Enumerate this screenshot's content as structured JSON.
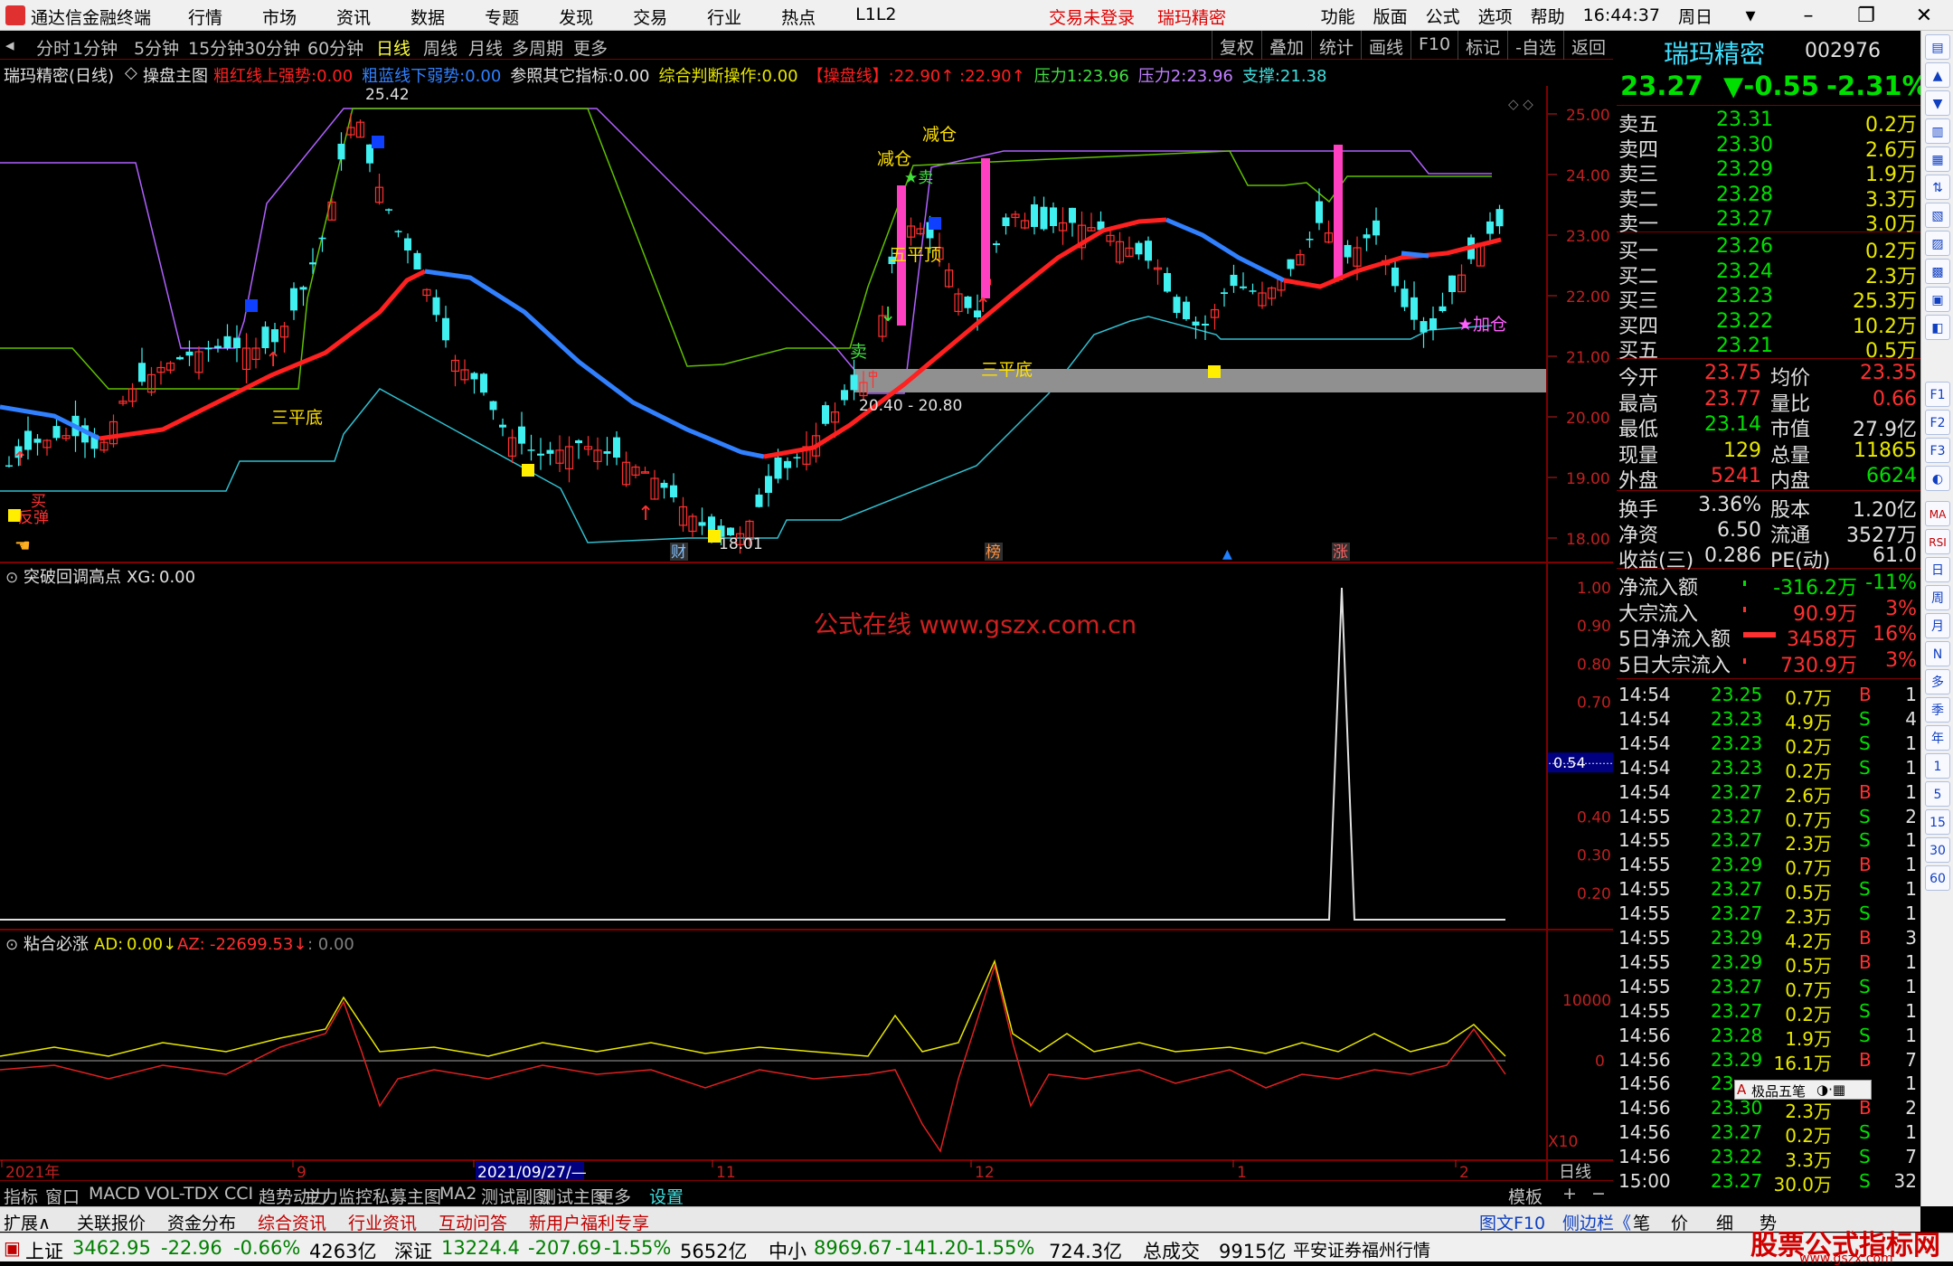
{
  "app": {
    "title": "通达信金融终端",
    "menus": [
      "行情",
      "市场",
      "资讯",
      "数据",
      "专题",
      "发现",
      "交易",
      "行业",
      "热点",
      "L1L2"
    ],
    "login_status": "交易未登录",
    "stock_title": "瑞玛精密",
    "top_right": [
      "功能",
      "版面",
      "公式",
      "选项",
      "帮助"
    ],
    "clock": "16:44:37",
    "weekday": "周日"
  },
  "period_bar": {
    "periods": [
      "分时",
      "1分钟",
      "5分钟",
      "15分钟",
      "30分钟",
      "60分钟",
      "日线",
      "周线",
      "月线",
      "多周期",
      "更多"
    ],
    "active": "日线",
    "tools": [
      "复权",
      "叠加",
      "统计",
      "画线",
      "F10",
      "标记",
      "-自选",
      "返回"
    ]
  },
  "info_bar": {
    "name": "瑞玛精密(日线)",
    "formula": "操盘主图",
    "items": [
      {
        "label": "粗红线上强势:",
        "value": "0.00",
        "color": "#ff2020"
      },
      {
        "label": "粗蓝线下弱势:",
        "value": "0.00",
        "color": "#3080ff"
      },
      {
        "label": "参照其它指标:",
        "value": "0.00",
        "color": "#e0e0e0"
      },
      {
        "label": "综合判断操作:",
        "value": "0.00",
        "color": "#e8e800"
      },
      {
        "label": "【操盘线】:",
        "value": "22.90↑ :22.90↑",
        "color": "#ff2020"
      },
      {
        "label": "压力1:",
        "value": "23.96",
        "color": "#40e040"
      },
      {
        "label": "压力2:",
        "value": "23.96",
        "color": "#c080ff"
      },
      {
        "label": "支撑:",
        "value": "21.38",
        "color": "#40e0e0"
      }
    ]
  },
  "main_chart": {
    "y_ticks": [
      "25.00",
      "24.00",
      "23.00",
      "22.00",
      "21.00",
      "20.00",
      "19.00",
      "18.00"
    ],
    "labels": {
      "high": "25.42",
      "low": "18.01",
      "range": "20.40 - 20.80",
      "sanpingdi_1": "三平底",
      "sanpingdi_2": "三平底",
      "wupingding": "五平顶",
      "sell": "卖",
      "buy": "买",
      "fantan": "反弹",
      "jiacang": "★加仓",
      "jianpan_1": "减仓",
      "jianpan_2": "减仓",
      "markers": [
        "财",
        "榜",
        "涨"
      ]
    }
  },
  "indicator1": {
    "name": "突破回调高点",
    "value_label": "XG:",
    "value": "0.00",
    "watermark": "公式在线  www.gszx.com.cn",
    "y_ticks": [
      "1.00",
      "0.90",
      "0.80",
      "0.70",
      "0.54",
      "0.40",
      "0.30",
      "0.20"
    ],
    "highlight": "0.54"
  },
  "indicator2": {
    "name": "粘合必涨",
    "ad_label": "AD:",
    "ad_value": "0.00↓",
    "az_label": "AZ:",
    "az_value": "-22699.53↓",
    "extra": ": 0.00",
    "y_ticks": [
      "10000",
      "0"
    ],
    "x10": "X10"
  },
  "x_axis": {
    "labels": [
      "2021年",
      "9",
      "2021/09/27/—",
      "11",
      "12",
      "1",
      "2"
    ],
    "period": "日线"
  },
  "bottom_tabs": {
    "tabs": [
      "指标",
      "窗口",
      "MACD",
      "VOL-TDX",
      "CCI",
      "趋势动力",
      "主力监控",
      "私募主图",
      "MA2",
      "测试副图",
      "测试主图",
      "更多",
      "设置"
    ],
    "right": [
      "模板",
      "+",
      "−"
    ]
  },
  "bottom_tabs2": {
    "tabs": [
      "扩展∧",
      "关联报价",
      "资金分布",
      "综合资讯",
      "行业资讯",
      "互动问答",
      "新用户福利专享"
    ],
    "right": [
      "图文F10",
      "侧边栏《",
      "笔",
      "价",
      "细",
      "势"
    ]
  },
  "quote": {
    "name": "瑞玛精密",
    "code": "002976",
    "price": "23.27",
    "change": "▼-0.55",
    "change_pct": "-2.31%",
    "asks": [
      {
        "label": "卖五",
        "price": "23.31",
        "vol": "0.2万"
      },
      {
        "label": "卖四",
        "price": "23.30",
        "vol": "2.6万"
      },
      {
        "label": "卖三",
        "price": "23.29",
        "vol": "1.9万"
      },
      {
        "label": "卖二",
        "price": "23.28",
        "vol": "3.3万"
      },
      {
        "label": "卖一",
        "price": "23.27",
        "vol": "3.0万"
      }
    ],
    "bids": [
      {
        "label": "买一",
        "price": "23.26",
        "vol": "0.2万"
      },
      {
        "label": "买二",
        "price": "23.24",
        "vol": "2.3万"
      },
      {
        "label": "买三",
        "price": "23.23",
        "vol": "25.3万"
      },
      {
        "label": "买四",
        "price": "23.22",
        "vol": "10.2万"
      },
      {
        "label": "买五",
        "price": "23.21",
        "vol": "0.5万"
      }
    ],
    "stats": [
      {
        "l1": "今开",
        "v1": "23.75",
        "l2": "均价",
        "v2": "23.35"
      },
      {
        "l1": "最高",
        "v1": "23.77",
        "l2": "量比",
        "v2": "0.66"
      },
      {
        "l1": "最低",
        "v1": "23.14",
        "l2": "市值",
        "v2": "27.9亿"
      },
      {
        "l1": "现量",
        "v1": "129",
        "l2": "总量",
        "v2": "11865"
      },
      {
        "l1": "外盘",
        "v1": "5241",
        "l2": "内盘",
        "v2": "6624"
      }
    ],
    "stats2": [
      {
        "l1": "换手",
        "v1": "3.36%",
        "l2": "股本",
        "v2": "1.20亿"
      },
      {
        "l1": "净资",
        "v1": "6.50",
        "l2": "流通",
        "v2": "3527万"
      },
      {
        "l1": "收益(三)",
        "v1": "0.286",
        "l2": "PE(动)",
        "v2": "61.0"
      }
    ],
    "flows": [
      {
        "label": "净流入额",
        "value": "-316.2万",
        "pct": "-11%"
      },
      {
        "label": "大宗流入",
        "value": "90.9万",
        "pct": "3%"
      },
      {
        "label": "5日净流入额",
        "value": "3458万",
        "pct": "16%"
      },
      {
        "label": "5日大宗流入",
        "value": "730.9万",
        "pct": "3%"
      }
    ],
    "ticks": [
      {
        "t": "14:54",
        "p": "23.25",
        "v": "0.7万",
        "s": "B",
        "n": "1"
      },
      {
        "t": "14:54",
        "p": "23.23",
        "v": "4.9万",
        "s": "S",
        "n": "4"
      },
      {
        "t": "14:54",
        "p": "23.23",
        "v": "0.2万",
        "s": "S",
        "n": "1"
      },
      {
        "t": "14:54",
        "p": "23.23",
        "v": "0.2万",
        "s": "S",
        "n": "1"
      },
      {
        "t": "14:54",
        "p": "23.27",
        "v": "2.6万",
        "s": "B",
        "n": "1"
      },
      {
        "t": "14:55",
        "p": "23.27",
        "v": "0.7万",
        "s": "S",
        "n": "2"
      },
      {
        "t": "14:55",
        "p": "23.27",
        "v": "2.3万",
        "s": "S",
        "n": "1"
      },
      {
        "t": "14:55",
        "p": "23.29",
        "v": "0.7万",
        "s": "B",
        "n": "1"
      },
      {
        "t": "14:55",
        "p": "23.27",
        "v": "0.5万",
        "s": "S",
        "n": "1"
      },
      {
        "t": "14:55",
        "p": "23.27",
        "v": "2.3万",
        "s": "S",
        "n": "1"
      },
      {
        "t": "14:55",
        "p": "23.29",
        "v": "4.2万",
        "s": "B",
        "n": "3"
      },
      {
        "t": "14:55",
        "p": "23.29",
        "v": "0.5万",
        "s": "B",
        "n": "1"
      },
      {
        "t": "14:55",
        "p": "23.27",
        "v": "0.7万",
        "s": "S",
        "n": "1"
      },
      {
        "t": "14:55",
        "p": "23.27",
        "v": "0.2万",
        "s": "S",
        "n": "1"
      },
      {
        "t": "14:56",
        "p": "23.28",
        "v": "1.9万",
        "s": "S",
        "n": "1"
      },
      {
        "t": "14:56",
        "p": "23.29",
        "v": "16.1万",
        "s": "B",
        "n": "7"
      },
      {
        "t": "14:56",
        "p": "23",
        "v": "",
        "s": "",
        "n": "1"
      },
      {
        "t": "14:56",
        "p": "23.30",
        "v": "2.3万",
        "s": "B",
        "n": "2"
      },
      {
        "t": "14:56",
        "p": "23.27",
        "v": "0.2万",
        "s": "S",
        "n": "1"
      },
      {
        "t": "14:56",
        "p": "23.22",
        "v": "3.3万",
        "s": "S",
        "n": "7"
      },
      {
        "t": "15:00",
        "p": "23.27",
        "v": "30.0万",
        "s": "S",
        "n": "32"
      }
    ],
    "ime_text": "极品五笔"
  },
  "sidebar": {
    "items": [
      "MA",
      "RSI",
      "日",
      "周",
      "月",
      "N",
      "多",
      "季",
      "年",
      "1",
      "5",
      "15",
      "30",
      "60"
    ]
  },
  "statusbar": {
    "sh_label": "上证",
    "sh_value": "3462.95",
    "sh_change": "-22.96",
    "sh_pct": "-0.66%",
    "sh_amount": "4263亿",
    "sz_label": "深证",
    "sz_value": "13224.4",
    "sz_change": "-207.69",
    "sz_pct": "-1.55%",
    "sz_amount": "5652亿",
    "zx_label": "中小",
    "zx_value": "8969.67",
    "zx_change": "-141.20",
    "zx_pct": "-1.55%",
    "zx_amount": "724.3亿",
    "total_label": "总成交",
    "total_value": "9915亿",
    "broker": "平安证券福州行情",
    "watermark": "股票公式指标网",
    "watermark_url": "www.gszx.com"
  }
}
